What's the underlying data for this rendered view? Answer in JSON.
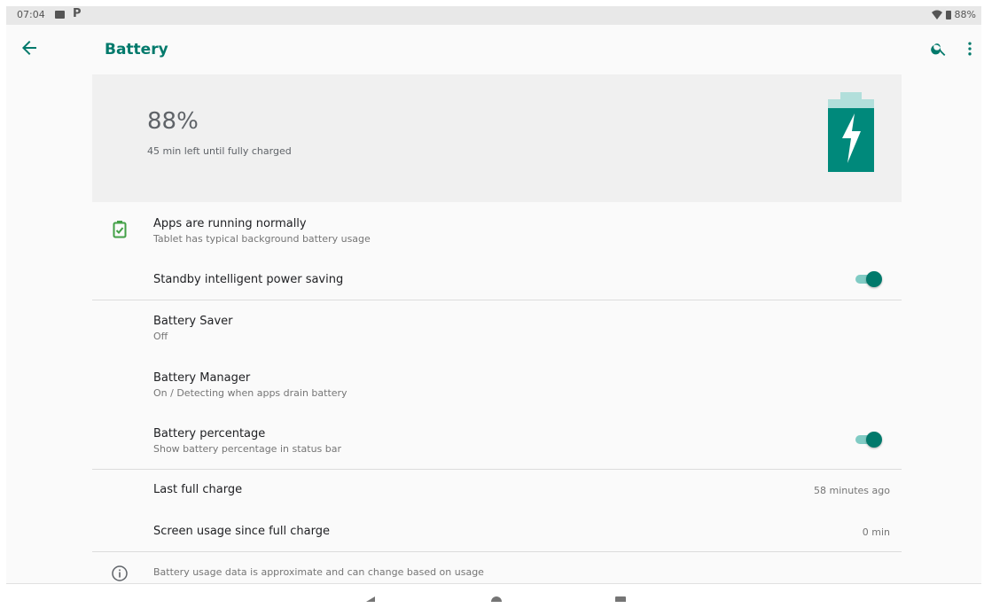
{
  "status_bar": {
    "time": "07:04",
    "battery": "88%"
  },
  "app_bar": {
    "title": "Battery"
  },
  "header": {
    "percent": "88%",
    "subtitle": "45 min left until fully charged"
  },
  "items": {
    "apps": {
      "title": "Apps are running normally",
      "subtitle": "Tablet has typical background battery usage"
    },
    "standby": {
      "title": "Standby intelligent power saving",
      "enabled": true
    },
    "saver": {
      "title": "Battery Saver",
      "subtitle": "Off"
    },
    "manager": {
      "title": "Battery Manager",
      "subtitle": "On / Detecting when apps drain battery"
    },
    "percentage": {
      "title": "Battery percentage",
      "subtitle": "Show battery percentage in status bar",
      "enabled": true
    },
    "last_charge": {
      "title": "Last full charge",
      "value": "58 minutes ago"
    },
    "screen_usage": {
      "title": "Screen usage since full charge",
      "value": "0 min"
    }
  },
  "footer": {
    "text": "Battery usage data is approximate and can change based on usage"
  },
  "colors": {
    "accent": "#00796b",
    "accent_light": "#80cbc4",
    "battery_icon": "#00897b"
  }
}
